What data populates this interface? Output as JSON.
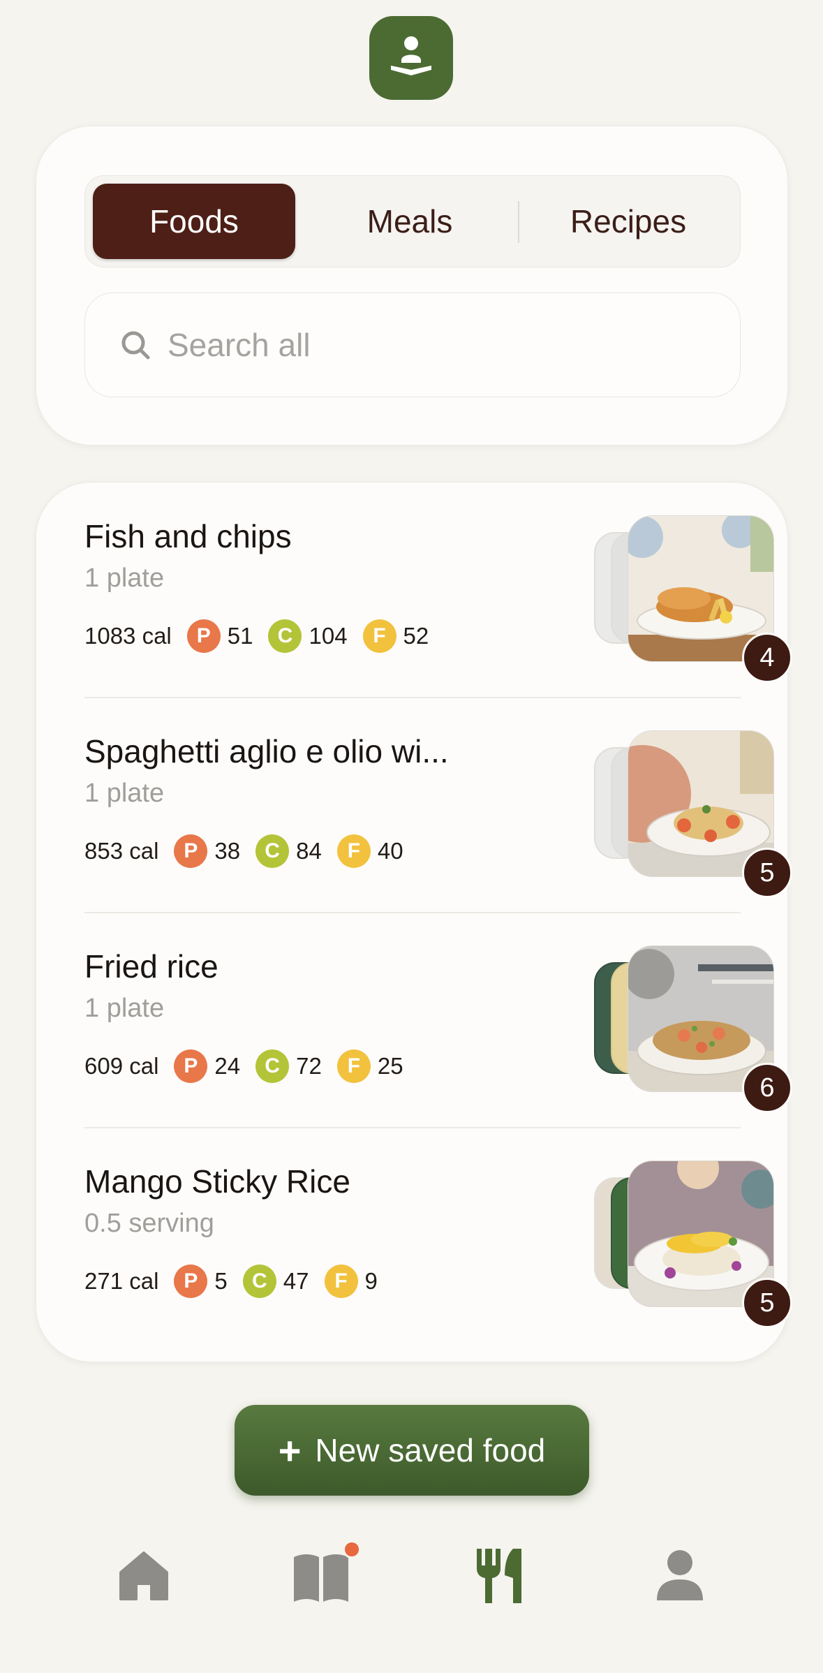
{
  "segments": {
    "foods": "Foods",
    "meals": "Meals",
    "recipes": "Recipes"
  },
  "search": {
    "placeholder": "Search all"
  },
  "items": [
    {
      "title": "Fish and chips",
      "serving": "1 plate",
      "cal": "1083 cal",
      "p": "51",
      "c": "104",
      "f": "52",
      "count": "4"
    },
    {
      "title": "Spaghetti aglio e olio wi...",
      "serving": "1 plate",
      "cal": "853 cal",
      "p": "38",
      "c": "84",
      "f": "40",
      "count": "5"
    },
    {
      "title": "Fried rice",
      "serving": "1 plate",
      "cal": "609 cal",
      "p": "24",
      "c": "72",
      "f": "25",
      "count": "6"
    },
    {
      "title": "Mango Sticky Rice",
      "serving": "0.5 serving",
      "cal": "271 cal",
      "p": "5",
      "c": "47",
      "f": "9",
      "count": "5"
    }
  ],
  "badges": {
    "p": "P",
    "c": "C",
    "f": "F"
  },
  "new_button": {
    "plus": "+",
    "label": "New saved food"
  },
  "tabbar": [
    "home-icon",
    "book-icon",
    "utensils-icon",
    "profile-icon"
  ],
  "colors": {
    "accent_green": "#4b6b33",
    "selected_segment": "#4d1f16",
    "notification_dot": "#e8683f"
  }
}
